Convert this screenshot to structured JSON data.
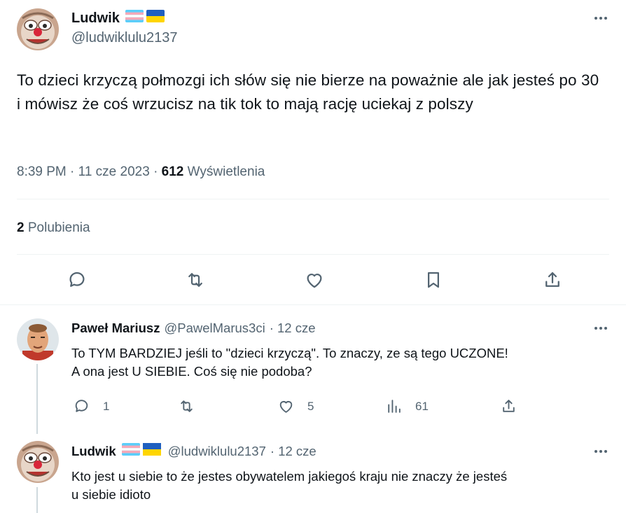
{
  "main_tweet": {
    "name": "Ludwik",
    "handle": "@ludwiklulu2137",
    "text": "To dzieci krzyczą połmozgi ich słów się nie bierze na poważnie ale jak jesteś po 30 i mówisz że coś wrzucisz na tik tok to mają rację uciekaj z polszy",
    "time": "8:39 PM",
    "date": "11 cze 2023",
    "views_count": "612",
    "views_label": "Wyświetlenia",
    "likes_count": "2",
    "likes_label": "Polubienia",
    "flags": [
      "transgender-flag",
      "ukraine-flag"
    ],
    "actions": [
      "reply-icon",
      "retweet-icon",
      "like-icon",
      "bookmark-icon",
      "share-icon"
    ]
  },
  "replies": [
    {
      "name": "Paweł Mariusz",
      "handle": "@PawelMarus3ci",
      "date": "· 12 cze",
      "text_line1": "To TYM BARDZIEJ  jeśli to \"dzieci krzyczą\". To znaczy, ze są tego UCZONE!",
      "text_line2": "A ona jest U SIEBIE. Coś się nie podoba?",
      "reply_count": "1",
      "retweet_count": "",
      "like_count": "5",
      "views_count": "61"
    },
    {
      "name": "Ludwik",
      "handle": "@ludwiklulu2137",
      "date": "· 12 cze",
      "text_line1": "Kto jest u siebie to że jestes obywatelem jakiegoś kraju nie znaczy że jesteś",
      "text_line2": "u siebie idioto"
    }
  ],
  "colors": {
    "text_primary": "#0f1419",
    "text_secondary": "#536471",
    "divider": "#eff3f4",
    "thread_line": "#cfd9de"
  }
}
